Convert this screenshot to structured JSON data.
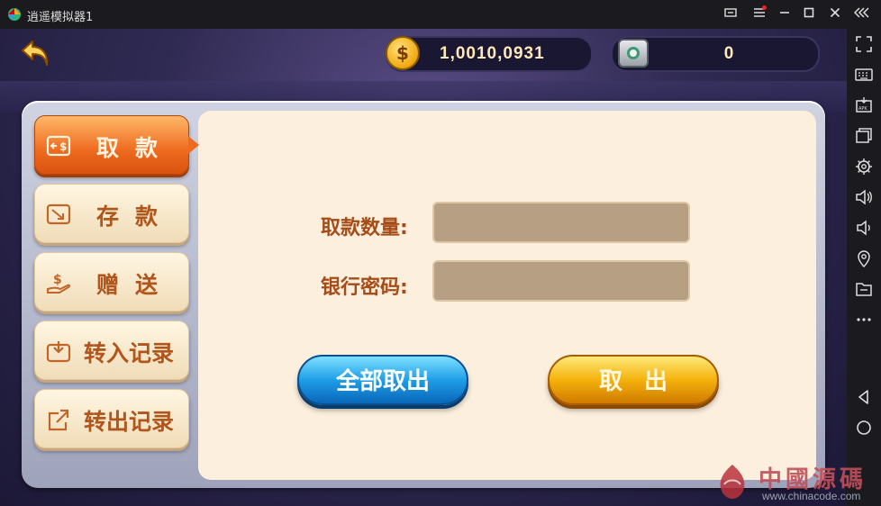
{
  "window": {
    "title": "逍遥模拟器1"
  },
  "header": {
    "gold_amount": "1,0010,0931",
    "bank_amount": "0"
  },
  "tabs": [
    {
      "label": "取款",
      "active": true
    },
    {
      "label": "存款",
      "active": false
    },
    {
      "label": "赠送",
      "active": false
    },
    {
      "label": "转入记录",
      "active": false
    },
    {
      "label": "转出记录",
      "active": false
    }
  ],
  "form": {
    "amount_label": "取款数量:",
    "amount_value": "",
    "password_label": "银行密码:",
    "password_value": ""
  },
  "buttons": {
    "withdraw_all": "全部取出",
    "withdraw": "取出"
  },
  "watermark": {
    "text": "中國源碼",
    "url": "www.chinacode.com"
  },
  "colors": {
    "active_tab": "#ee6a1e",
    "panel_bg": "#fcefdd",
    "label_text": "#a54d18",
    "input_bg": "#b79f83",
    "blue_button": "#1e9ee8",
    "gold_button": "#f4b20c"
  },
  "icons": {
    "toolbar": [
      "fullscreen-icon",
      "keyboard-icon",
      "apk-install-icon",
      "multi-window-icon",
      "settings-icon",
      "volume-up-icon",
      "volume-down-icon",
      "location-icon",
      "folder-icon",
      "more-icon",
      "back-nav-icon",
      "home-nav-icon"
    ]
  }
}
